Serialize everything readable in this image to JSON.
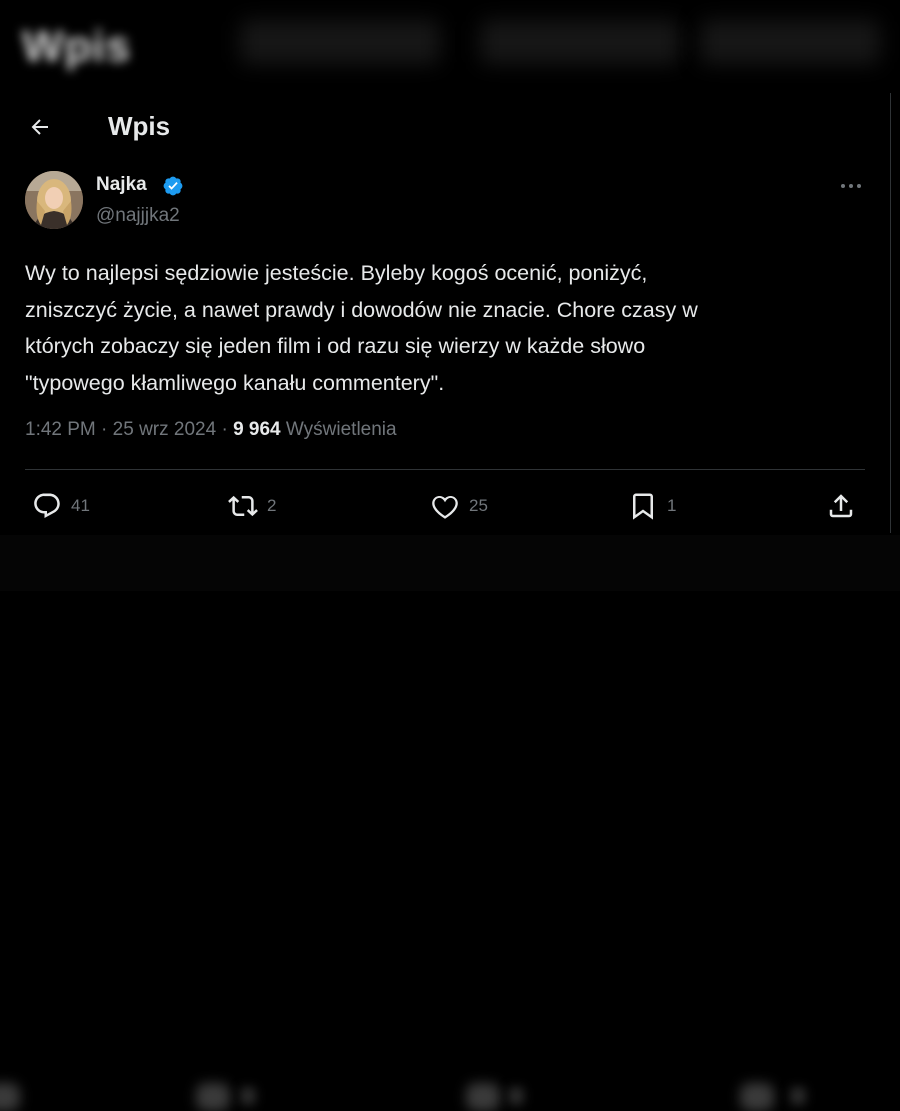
{
  "background": {
    "title": "Wpis"
  },
  "header": {
    "back_icon": "arrow-left-icon",
    "title": "Wpis"
  },
  "author": {
    "name": "Najka",
    "handle": "@najjjka2",
    "verified_icon": "verified-badge-icon",
    "verified_color": "#1d9bf0"
  },
  "tweet": {
    "text": "Wy to najlepsi sędziowie jesteście. Byleby kogoś ocenić, poniżyć,\nzniszczyć życie, a nawet prawdy i dowodów nie znacie. Chore czasy w\nktórych zobaczy się jeden film i od razu się wierzy w każde słowo\n\"typowego kłamliwego kanału commentery\".",
    "time": "1:42 PM",
    "separator": "·",
    "date": "25 wrz 2024",
    "views_count": "9 964",
    "views_label": "Wyświetlenia"
  },
  "actions": {
    "reply": {
      "icon": "reply-icon",
      "count": "41"
    },
    "retweet": {
      "icon": "retweet-icon",
      "count": "2"
    },
    "like": {
      "icon": "heart-icon",
      "count": "25"
    },
    "bookmark": {
      "icon": "bookmark-icon",
      "count": "1"
    },
    "share": {
      "icon": "share-icon"
    }
  },
  "colors": {
    "background": "#000000",
    "text_primary": "#e7e9ea",
    "text_secondary": "#71767b",
    "divider": "#2f3336",
    "accent": "#1d9bf0"
  }
}
